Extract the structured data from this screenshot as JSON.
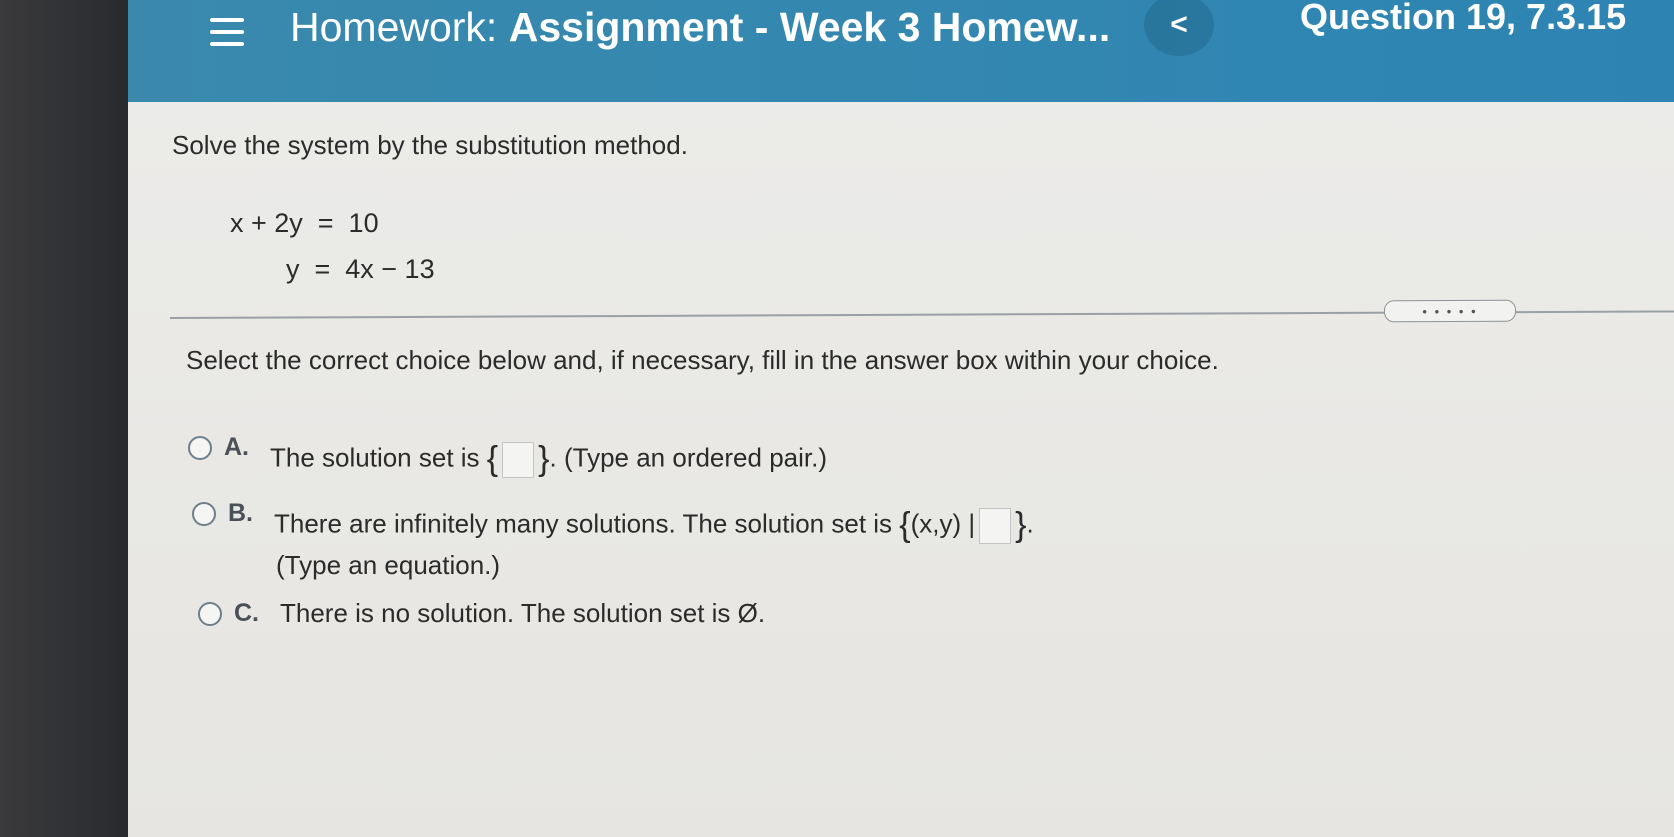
{
  "header": {
    "title_prefix": "Homework:",
    "title_name": "Assignment - Week 3 Homew...",
    "back_label": "<",
    "question_info": "Question 19, 7.3.15"
  },
  "problem": {
    "instruction": "Solve the system by the substitution method.",
    "equation1": "x + 2y  =  10",
    "equation2": "y  =  4x − 13"
  },
  "more_label": "• • • • •",
  "select_text": "Select the correct choice below and, if necessary, fill in the answer box within your choice.",
  "choices": [
    {
      "letter": "A.",
      "text_before": "The solution set is",
      "brace_open": "{",
      "brace_close": "}",
      "text_after": ". (Type an ordered pair.)"
    },
    {
      "letter": "B.",
      "text_before": "There are infinitely many solutions. The solution set is",
      "brace_open": "{",
      "set_prefix": "(x,y) |",
      "brace_close": "}",
      "text_after": ".",
      "line2": "(Type an equation.)"
    },
    {
      "letter": "C.",
      "text": "There is no solution. The solution set is Ø."
    }
  ]
}
